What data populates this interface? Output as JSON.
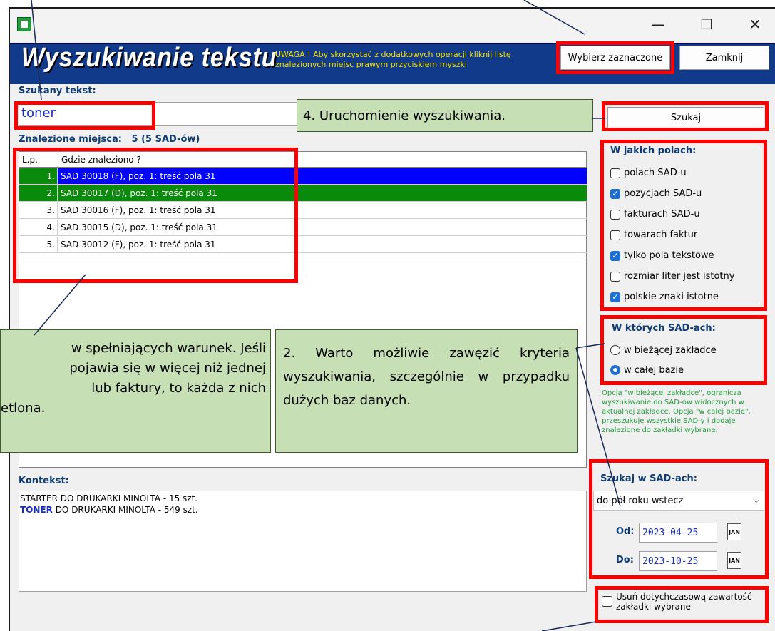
{
  "window": {
    "minimize_glyph": "—",
    "maximize_glyph": "☐",
    "close_glyph": "✕"
  },
  "header": {
    "title": "Wyszukiwanie tekstu",
    "warning": "UWAGA ! Aby skorzystać z dodatkowych operacji kliknij listę znalezionych miejsc prawym przyciskiem myszki",
    "select_button": "Wybierz zaznaczone",
    "close_button": "Zamknij"
  },
  "search": {
    "label": "Szukany tekst:",
    "value": "toner",
    "search_button": "Szukaj"
  },
  "results": {
    "label": "Znalezione miejsca:",
    "count": "5 (5 SAD-ów)",
    "columns": [
      "L.p.",
      "Gdzie znaleziono ?"
    ],
    "rows": [
      {
        "lp": "1.",
        "where": "SAD 30018 (F), poz. 1: treść pola 31"
      },
      {
        "lp": "2.",
        "where": "SAD 30017 (D), poz. 1: treść pola 31"
      },
      {
        "lp": "3.",
        "where": "SAD 30016 (F), poz. 1: treść pola 31"
      },
      {
        "lp": "4.",
        "where": "SAD 30015 (D), poz. 1: treść pola 31"
      },
      {
        "lp": "5.",
        "where": "SAD 30012 (F), poz. 1: treść pola 31"
      }
    ]
  },
  "context": {
    "label": "Kontekst:",
    "line1": "STARTER DO DRUKARKI MINOLTA - 15 szt.",
    "line2_highlight": "TONER",
    "line2_rest": " DO DRUKARKI MINOLTA - 549 szt."
  },
  "fields_panel": {
    "title": "W jakich polach:",
    "items": [
      {
        "label": "polach SAD-u",
        "checked": false
      },
      {
        "label": "pozycjach SAD-u",
        "checked": true
      },
      {
        "label": "fakturach SAD-u",
        "checked": false
      },
      {
        "label": "towarach faktur",
        "checked": false
      },
      {
        "label": "tylko pola tekstowe",
        "checked": true
      },
      {
        "label": "rozmiar liter jest istotny",
        "checked": false
      },
      {
        "label": "polskie znaki istotne",
        "checked": true
      }
    ]
  },
  "sad_panel": {
    "title": "W których SAD-ach:",
    "options": [
      {
        "label": "w bieżącej zakładce",
        "selected": false
      },
      {
        "label": "w całej bazie",
        "selected": true
      }
    ],
    "note": "Opcja \"w bieżącej zakładce\", ogranicza wyszukiwanie do SAD-ów widocznych w aktualnej zakładce. Opcja \"w całej bazie\", przeszukuje wszystkie SAD-y i dodaje znalezione do zakładki wybrane."
  },
  "range_panel": {
    "title": "Szukaj w SAD-ach:",
    "selected": "do pół roku wstecz",
    "from_label": "Od:",
    "from_value": "2023-04-25",
    "to_label": "Do:",
    "to_value": "2023-10-25",
    "cal_text": "JAN"
  },
  "clear_option": {
    "label": "Usuń dotychczasową zawartość zakładki wybrane"
  },
  "callouts": {
    "c4": "4. Uruchomienie wyszukiwania.",
    "c2": "2. Warto możliwie zawęzić kryteria wyszukiwania, szczególnie w przypadku dużych baz danych.",
    "c_left_l1": "w spełniających warunek. Jeśli",
    "c_left_l2": "pojawia się w więcej niż jednej",
    "c_left_l3": "lub faktury, to każda z nich",
    "c_left_l4": "etlona."
  },
  "colors": {
    "selected_row_1": "#0000ff",
    "selected_row_2": "#0a8a0a",
    "callout_bg": "#c6dfb4",
    "highlight": "#ff0000"
  }
}
